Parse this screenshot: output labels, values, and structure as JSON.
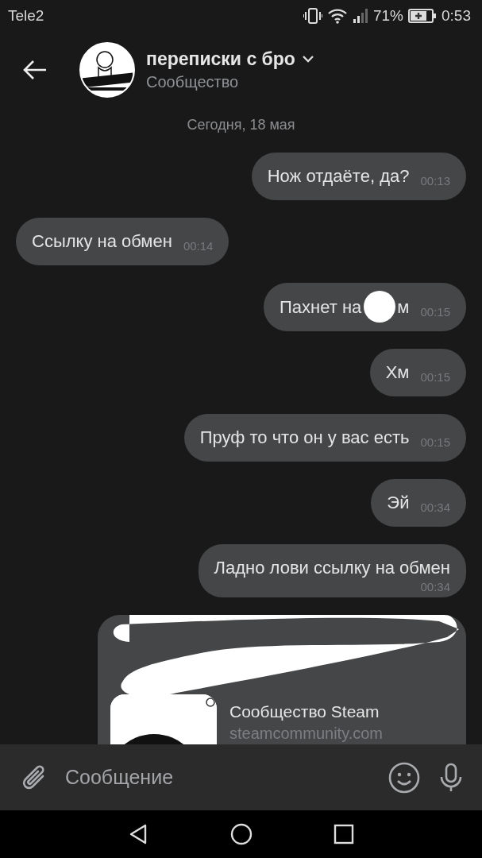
{
  "status_bar": {
    "carrier": "Tele2",
    "battery": "71%",
    "time": "0:53"
  },
  "header": {
    "title": "переписки с бро",
    "subtitle": "Сообщество"
  },
  "date_divider": "Сегодня, 18 мая",
  "messages": [
    {
      "kind": "text",
      "outgoing": true,
      "text": "Нож отдаёте, да?",
      "time": "00:13"
    },
    {
      "kind": "text",
      "outgoing": false,
      "text": "Ссылку на обмен",
      "time": "00:14"
    },
    {
      "kind": "redacted",
      "outgoing": true,
      "text_before": "Пахнет на",
      "text_after": "м",
      "time": "00:15"
    },
    {
      "kind": "text",
      "outgoing": true,
      "text": "Хм",
      "time": "00:15"
    },
    {
      "kind": "text",
      "outgoing": true,
      "text": "Пруф то что он у вас есть",
      "time": "00:15"
    },
    {
      "kind": "text",
      "outgoing": true,
      "text": "Эй",
      "time": "00:34"
    },
    {
      "kind": "wrapped",
      "outgoing": true,
      "text": "Ладно лови ссылку на обмен",
      "time": "00:34"
    },
    {
      "kind": "link",
      "outgoing": true,
      "title": "Сообщество Steam",
      "domain": "steamcommunity.com"
    }
  ],
  "composer": {
    "placeholder": "Сообщение"
  }
}
